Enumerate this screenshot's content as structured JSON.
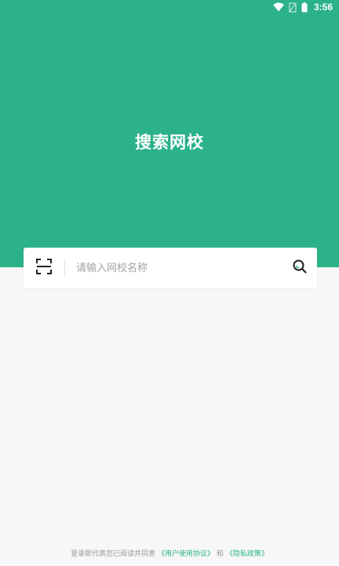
{
  "status_bar": {
    "time": "3:56",
    "icons": [
      "wifi-icon",
      "no-sim-icon",
      "battery-icon"
    ]
  },
  "header": {
    "title": "搜索网校",
    "color": "#2bb28b"
  },
  "search": {
    "placeholder": "请输入网校名称",
    "value": "",
    "scan_icon": "scan-icon",
    "search_icon": "search-icon"
  },
  "footer": {
    "prefix": "登录即代表您已阅读并同意",
    "user_agreement": "《用户使用协议》",
    "conjunction": "和",
    "privacy_policy": "《隐私政策》",
    "link_color": "#2bb28b"
  }
}
